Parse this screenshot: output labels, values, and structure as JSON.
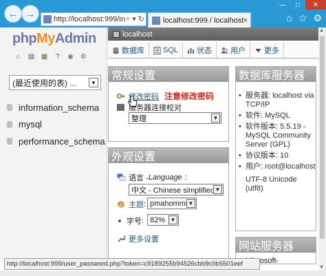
{
  "browser": {
    "address_url": "http://localhost:999/in",
    "address_controls": [
      "⌕",
      "▾",
      "↻"
    ],
    "tab_title": "localhost:999 / localhost",
    "tab_close": "×",
    "window_controls": [
      "—",
      "□",
      "✕"
    ]
  },
  "nav": {
    "logo_php": "php",
    "logo_my": "My",
    "logo_admin": "Admin",
    "db_select_value": "(最近使用的表) ...",
    "databases": [
      "information_schema",
      "mysql",
      "performance_schema"
    ]
  },
  "server_bar": {
    "label": "localhost"
  },
  "main_tabs": [
    {
      "label": "数据库",
      "icon": "database-icon"
    },
    {
      "label": "SQL",
      "icon": "sql-icon"
    },
    {
      "label": "状态",
      "icon": "status-icon"
    },
    {
      "label": "用户",
      "icon": "users-icon"
    },
    {
      "label": "更多",
      "icon": "chevron-down-icon"
    }
  ],
  "general_settings": {
    "title": "常规设置",
    "change_password": "修改密码",
    "change_password_note": "注意修改密码",
    "collation_label": "服务器连接校对",
    "collation_value": "整理"
  },
  "appearance_settings": {
    "title": "外观设置",
    "language_label": "语言 - ",
    "language_label_en": "Language",
    "language_suffix": ":",
    "language_value": "中文 - Chinese simplified",
    "theme_label": "主题",
    "theme_colon": ":",
    "theme_value": "pmahomme",
    "font_label": "字号",
    "font_colon": ":",
    "font_value": "82%",
    "more_settings": "更多设置"
  },
  "db_server": {
    "title": "数据库服务器",
    "items": [
      "服务器: localhost via TCP/IP",
      "软件: MySQL",
      "软件版本: 5.5.19 - MySQL Community Server (GPL)",
      "协议版本: 10",
      "用户: root@localhost",
      "UTF-8 Unicode (utf8)"
    ]
  },
  "web_server": {
    "title": "网站服务器",
    "first_item": "Microsoft-"
  },
  "status_bar": {
    "url": "http://localhost:999/user_password.php?token=c9189255b94526cbb9c0b5501eef"
  }
}
